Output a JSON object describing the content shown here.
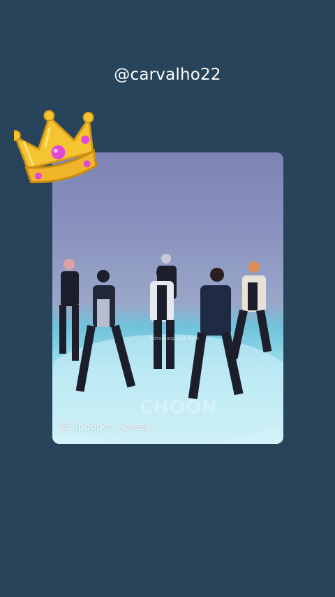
{
  "profile": {
    "username": "@carvalho22"
  },
  "media": {
    "watermark": "@K-popper_Korean",
    "small_watermark": "@dramaappest_fans",
    "floor_logo": "CHOON"
  },
  "sticker": {
    "icon": "crown-icon"
  },
  "colors": {
    "background": "#27445a",
    "crown_gold": "#f5c531",
    "crown_gem": "#e14ad6"
  }
}
